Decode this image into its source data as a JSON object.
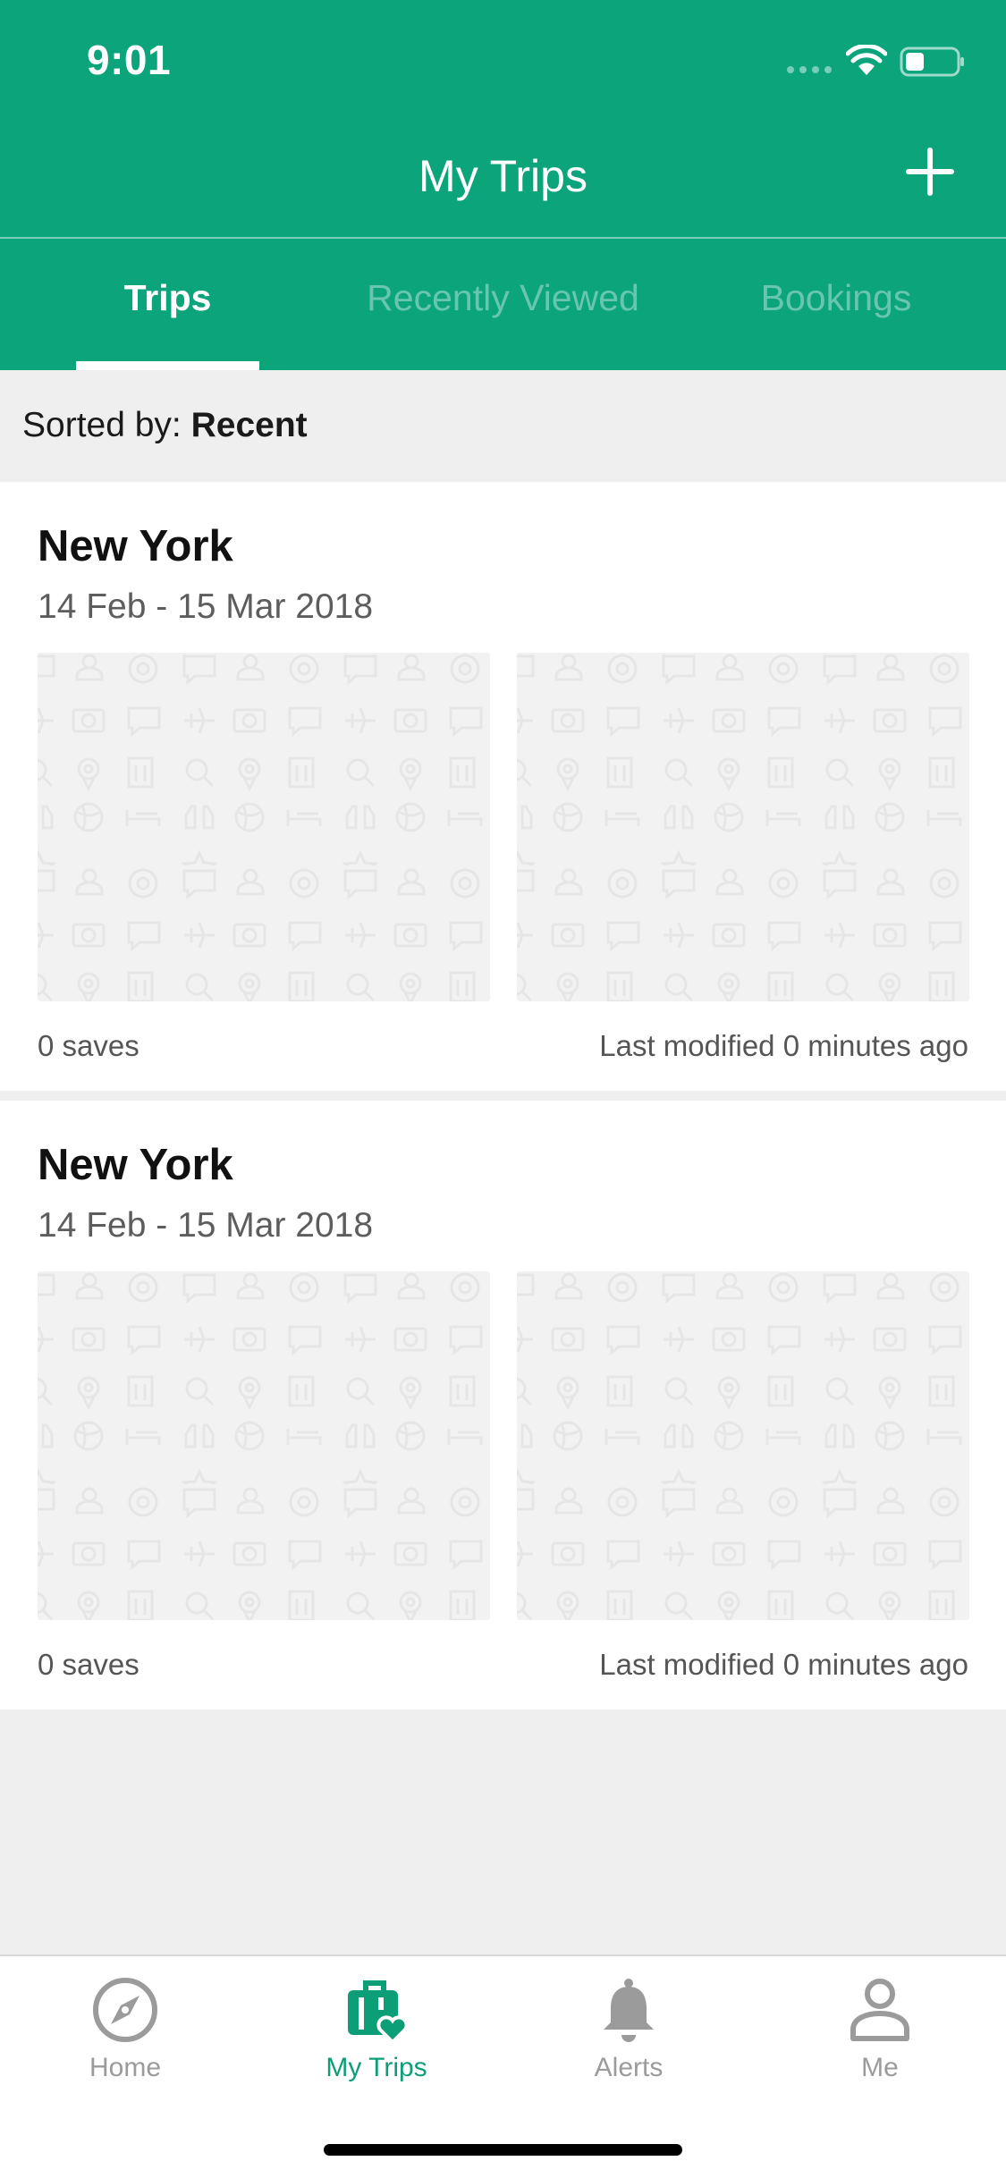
{
  "status_bar": {
    "time": "9:01"
  },
  "header": {
    "title": "My Trips",
    "tabs": [
      {
        "label": "Trips",
        "active": true
      },
      {
        "label": "Recently Viewed",
        "active": false
      },
      {
        "label": "Bookings",
        "active": false
      }
    ]
  },
  "sort": {
    "prefix": "Sorted by: ",
    "value": "Recent"
  },
  "trips": [
    {
      "name": "New York",
      "dates": "14 Feb - 15 Mar 2018",
      "saves": "0 saves",
      "modified": "Last modified 0 minutes ago"
    },
    {
      "name": "New York",
      "dates": "14 Feb - 15 Mar 2018",
      "saves": "0 saves",
      "modified": "Last modified 0 minutes ago"
    }
  ],
  "tabbar": {
    "items": [
      {
        "label": "Home",
        "icon": "compass-icon",
        "active": false
      },
      {
        "label": "My Trips",
        "icon": "suitcase-heart-icon",
        "active": true
      },
      {
        "label": "Alerts",
        "icon": "bell-icon",
        "active": false
      },
      {
        "label": "Me",
        "icon": "person-icon",
        "active": false
      }
    ]
  },
  "colors": {
    "brand": "#0ba47b",
    "active_tab_label": "#0b9e77",
    "inactive": "#9b9b9b"
  }
}
